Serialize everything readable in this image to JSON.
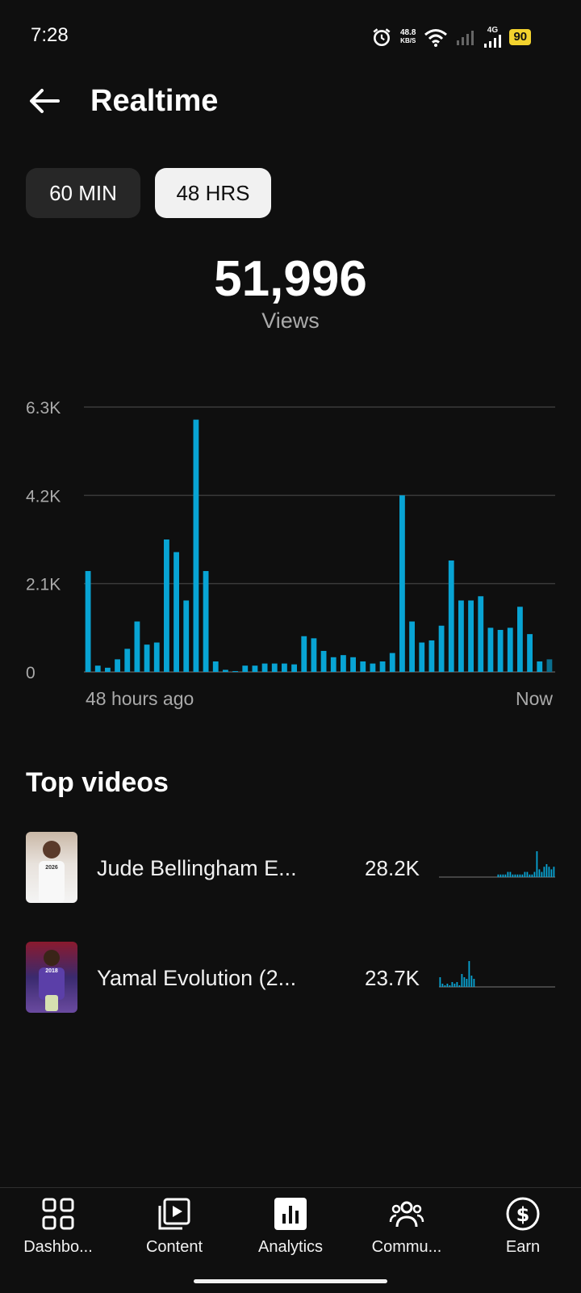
{
  "status_bar": {
    "time": "7:28",
    "net_speed_value": "48.8",
    "net_speed_unit": "KB/S",
    "network_type": "4G",
    "battery": "90",
    "icons": [
      "alarm-icon",
      "wifi-icon",
      "signal-icon",
      "signal-4g-icon",
      "battery-icon"
    ]
  },
  "header": {
    "title": "Realtime",
    "back_icon": "arrow-left-icon"
  },
  "range_tabs": [
    {
      "label": "60 MIN",
      "selected": false
    },
    {
      "label": "48 HRS",
      "selected": true
    }
  ],
  "stats": {
    "total": "51,996",
    "label": "Views"
  },
  "chart_data": {
    "type": "bar",
    "series": [
      {
        "values": [
          2400,
          150,
          100,
          300,
          550,
          1200,
          650,
          700,
          3150,
          2850,
          1700,
          6000,
          2400,
          250,
          50,
          20,
          150,
          150,
          200,
          200,
          200,
          180,
          850,
          800,
          500,
          350,
          400,
          350,
          250,
          200,
          250,
          450,
          4200,
          1200,
          700,
          750,
          1100,
          2650,
          1700,
          1700,
          1800,
          1050,
          1000,
          1050,
          1550,
          900,
          250,
          300
        ]
      }
    ],
    "ylim": [
      0,
      6300
    ],
    "yticks": [
      "6.3K",
      "4.2K",
      "2.1K",
      "0"
    ],
    "ytick_values": [
      6300,
      4200,
      2100,
      0
    ],
    "x_start_label": "48 hours ago",
    "x_end_label": "Now",
    "bar_color": "#08a4d4",
    "grid": true
  },
  "top_videos": {
    "title": "Top videos",
    "items": [
      {
        "title": "Jude Bellingham E...",
        "views": "28.2K",
        "thumb_text": "2026",
        "spark": [
          0,
          0,
          0,
          0,
          0,
          0,
          0,
          0,
          0,
          0,
          0,
          0,
          0,
          0,
          0,
          0,
          0,
          0,
          0,
          0,
          0,
          0,
          0,
          0,
          1,
          1,
          1,
          1,
          2,
          2,
          1,
          1,
          1,
          1,
          1,
          2,
          2,
          1,
          1,
          2,
          10,
          3,
          2,
          4,
          5,
          4,
          3,
          4,
          4,
          3,
          3,
          2,
          3,
          4,
          3,
          2
        ]
      },
      {
        "title": "Yamal Evolution (2...",
        "views": "23.7K",
        "thumb_text": "2018",
        "spark": [
          6,
          2,
          1,
          2,
          1,
          3,
          2,
          3,
          1,
          8,
          6,
          5,
          16,
          7,
          5
        ]
      }
    ]
  },
  "bottom_nav": [
    {
      "label": "Dashbo...",
      "icon": "dashboard-grid-icon"
    },
    {
      "label": "Content",
      "icon": "content-playlist-icon"
    },
    {
      "label": "Analytics",
      "icon": "analytics-chart-icon",
      "selected": true
    },
    {
      "label": "Commu...",
      "icon": "community-people-icon"
    },
    {
      "label": "Earn",
      "icon": "dollar-icon"
    }
  ]
}
